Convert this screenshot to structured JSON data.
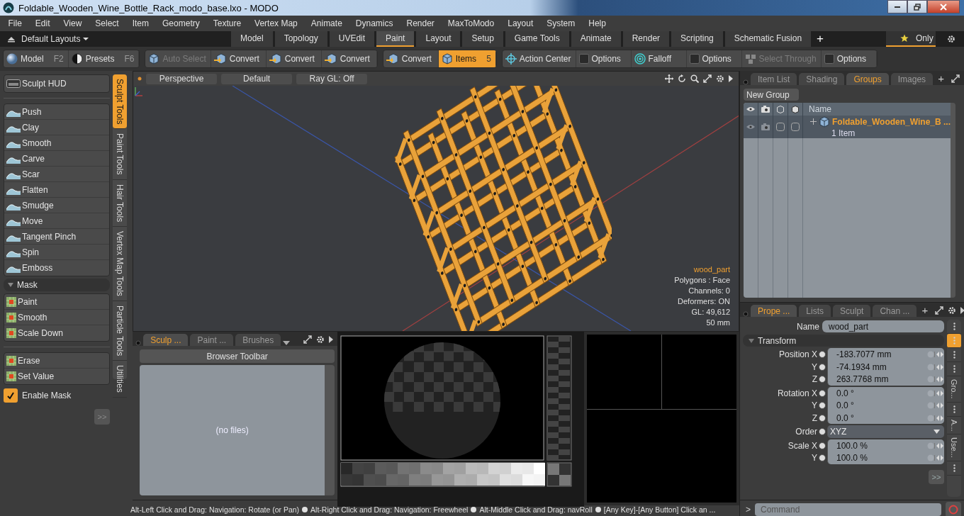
{
  "window": {
    "title": "Foldable_Wooden_Wine_Bottle_Rack_modo_base.lxo - MODO"
  },
  "menu": [
    "File",
    "Edit",
    "View",
    "Select",
    "Item",
    "Geometry",
    "Texture",
    "Vertex Map",
    "Animate",
    "Dynamics",
    "Render",
    "MaxToModo",
    "Layout",
    "System",
    "Help"
  ],
  "layout_bar": {
    "layouts": "Default Layouts",
    "tabs": [
      {
        "label": "Model",
        "selected": false
      },
      {
        "label": "Topology",
        "selected": false
      },
      {
        "label": "UVEdit",
        "selected": false
      },
      {
        "label": "Paint",
        "selected": true
      },
      {
        "label": "Layout",
        "selected": false
      },
      {
        "label": "Setup",
        "selected": false
      },
      {
        "label": "Game Tools",
        "selected": false
      },
      {
        "label": "Animate",
        "selected": false
      },
      {
        "label": "Render",
        "selected": false
      },
      {
        "label": "Scripting",
        "selected": false
      },
      {
        "label": "Schematic Fusion",
        "selected": false
      }
    ],
    "add": "+",
    "filter": {
      "label": "Only",
      "on": true
    }
  },
  "toolbar": {
    "groups": [
      {
        "items": [
          {
            "kind": "sphere",
            "label": "Model",
            "shortcut": "F2",
            "selected": false,
            "disabled": false
          },
          {
            "kind": "presets",
            "label": "Presets",
            "shortcut": "F6",
            "selected": false,
            "disabled": false
          }
        ]
      },
      {
        "items": [
          {
            "kind": "cube",
            "label": "Auto Select",
            "selected": false,
            "disabled": true
          },
          {
            "kind": "convert",
            "label": "Convert",
            "selected": false,
            "disabled": false
          },
          {
            "kind": "convert",
            "label": "Convert",
            "selected": false,
            "disabled": false
          },
          {
            "kind": "convert",
            "label": "Convert",
            "selected": false,
            "disabled": false
          }
        ]
      },
      {
        "items": [
          {
            "kind": "convert",
            "label": "Convert",
            "selected": false,
            "disabled": false
          },
          {
            "kind": "cube",
            "label": "Items",
            "shortcut": "5",
            "selected": true,
            "disabled": false
          }
        ]
      },
      {
        "items": [
          {
            "kind": "target",
            "label": "Action Center",
            "selected": false,
            "disabled": false
          },
          {
            "kind": "options",
            "label": "Options",
            "selected": false,
            "disabled": false
          },
          {
            "kind": "falloff",
            "label": "Falloff",
            "selected": false,
            "disabled": false
          },
          {
            "kind": "options",
            "label": "Options",
            "selected": false,
            "disabled": false
          },
          {
            "kind": "through",
            "label": "Select Through",
            "selected": false,
            "disabled": true
          },
          {
            "kind": "options",
            "label": "Options",
            "selected": false,
            "disabled": false
          }
        ]
      }
    ]
  },
  "left_panel": {
    "hud": "Sculpt HUD",
    "tools": [
      "Push",
      "Clay",
      "Smooth",
      "Carve",
      "Scar",
      "Flatten",
      "Smudge",
      "Move",
      "Tangent Pinch",
      "Spin",
      "Emboss"
    ],
    "mask": {
      "title": "Mask",
      "expanded": true,
      "tools": [
        "Paint",
        "Smooth",
        "Scale Down"
      ]
    },
    "mask_tools": [
      "Erase",
      "Set Value"
    ],
    "enable_mask": {
      "label": "Enable Mask",
      "checked": true
    },
    "more": ">>",
    "tabs": [
      {
        "label": "Sculpt Tools",
        "selected": true
      },
      {
        "label": "Paint Tools",
        "selected": false
      },
      {
        "label": "Hair Tools",
        "selected": false
      },
      {
        "label": "Vertex Map Tools",
        "selected": false
      },
      {
        "label": "Particle Tools",
        "selected": false
      },
      {
        "label": "Utilities",
        "selected": false
      }
    ]
  },
  "viewport": {
    "view": "Perspective",
    "style": "Default",
    "ray_gl": "Ray GL: Off",
    "info": [
      "wood_part",
      "Polygons : Face",
      "Channels: 0",
      "Deformers: ON",
      "GL: 49,612",
      "50 mm"
    ]
  },
  "browser": {
    "tabs": [
      {
        "label": "Sculp ...",
        "selected": true
      },
      {
        "label": "Paint ...",
        "selected": false
      },
      {
        "label": "Brushes",
        "selected": false
      }
    ],
    "toolbar": "Browser Toolbar",
    "empty": "(no files)"
  },
  "groups_panel": {
    "tabs": [
      {
        "label": "Item List",
        "selected": false
      },
      {
        "label": "Shading",
        "selected": false
      },
      {
        "label": "Groups",
        "selected": true
      },
      {
        "label": "Images",
        "selected": false
      }
    ],
    "add": "+",
    "new_group": "New Group",
    "name_column": "Name",
    "rows": [
      {
        "name": "Foldable_Wooden_Wine_B ...",
        "count": "1 Item",
        "expanded": false
      }
    ]
  },
  "properties": {
    "tabs": [
      {
        "label": "Prope ...",
        "selected": true
      },
      {
        "label": "Lists",
        "selected": false
      },
      {
        "label": "Sculpt",
        "selected": false
      },
      {
        "label": "Chan ...",
        "selected": false
      }
    ],
    "add": "+",
    "name_label": "Name",
    "name_value": "wood_part",
    "section": {
      "title": "Transform",
      "expanded": true,
      "groups": [
        {
          "kind": "numeric",
          "rows": [
            {
              "label": "Position X",
              "value": "-183.7077 mm"
            },
            {
              "label": "Y",
              "value": "-74.1934 mm"
            },
            {
              "label": "Z",
              "value": "263.7768 mm"
            }
          ]
        },
        {
          "kind": "numeric",
          "rows": [
            {
              "label": "Rotation X",
              "value": "0.0 °"
            },
            {
              "label": "Y",
              "value": "0.0 °"
            },
            {
              "label": "Z",
              "value": "0.0 °"
            }
          ]
        },
        {
          "kind": "dropdown",
          "rows": [
            {
              "label": "Order",
              "value": "XYZ"
            }
          ]
        },
        {
          "kind": "numeric",
          "rows": [
            {
              "label": "Scale X",
              "value": "100.0 %"
            },
            {
              "label": "Y",
              "value": "100.0 %"
            }
          ]
        }
      ]
    },
    "more": ">>",
    "side_tabs": [
      {
        "kind": "icon",
        "selected": false
      },
      {
        "kind": "icon",
        "selected": true
      },
      {
        "kind": "icon",
        "selected": false
      },
      {
        "kind": "icon",
        "selected": false
      },
      {
        "kind": "label",
        "label": "Gro...",
        "selected": false
      },
      {
        "kind": "icon",
        "selected": false
      },
      {
        "kind": "label",
        "label": "A...",
        "selected": false
      },
      {
        "kind": "label",
        "label": "Use...",
        "selected": false
      },
      {
        "kind": "icon",
        "selected": false
      }
    ]
  },
  "status": {
    "hints": [
      "Alt-Left Click and Drag: Navigation: Rotate (or Pan)",
      "Alt-Right Click and Drag: Navigation: Freewheel",
      "Alt-Middle Click and Drag: navRoll",
      "[Any Key]-[Any Button] Click an ..."
    ]
  },
  "command": {
    "prompt": ">",
    "placeholder": "Command"
  }
}
